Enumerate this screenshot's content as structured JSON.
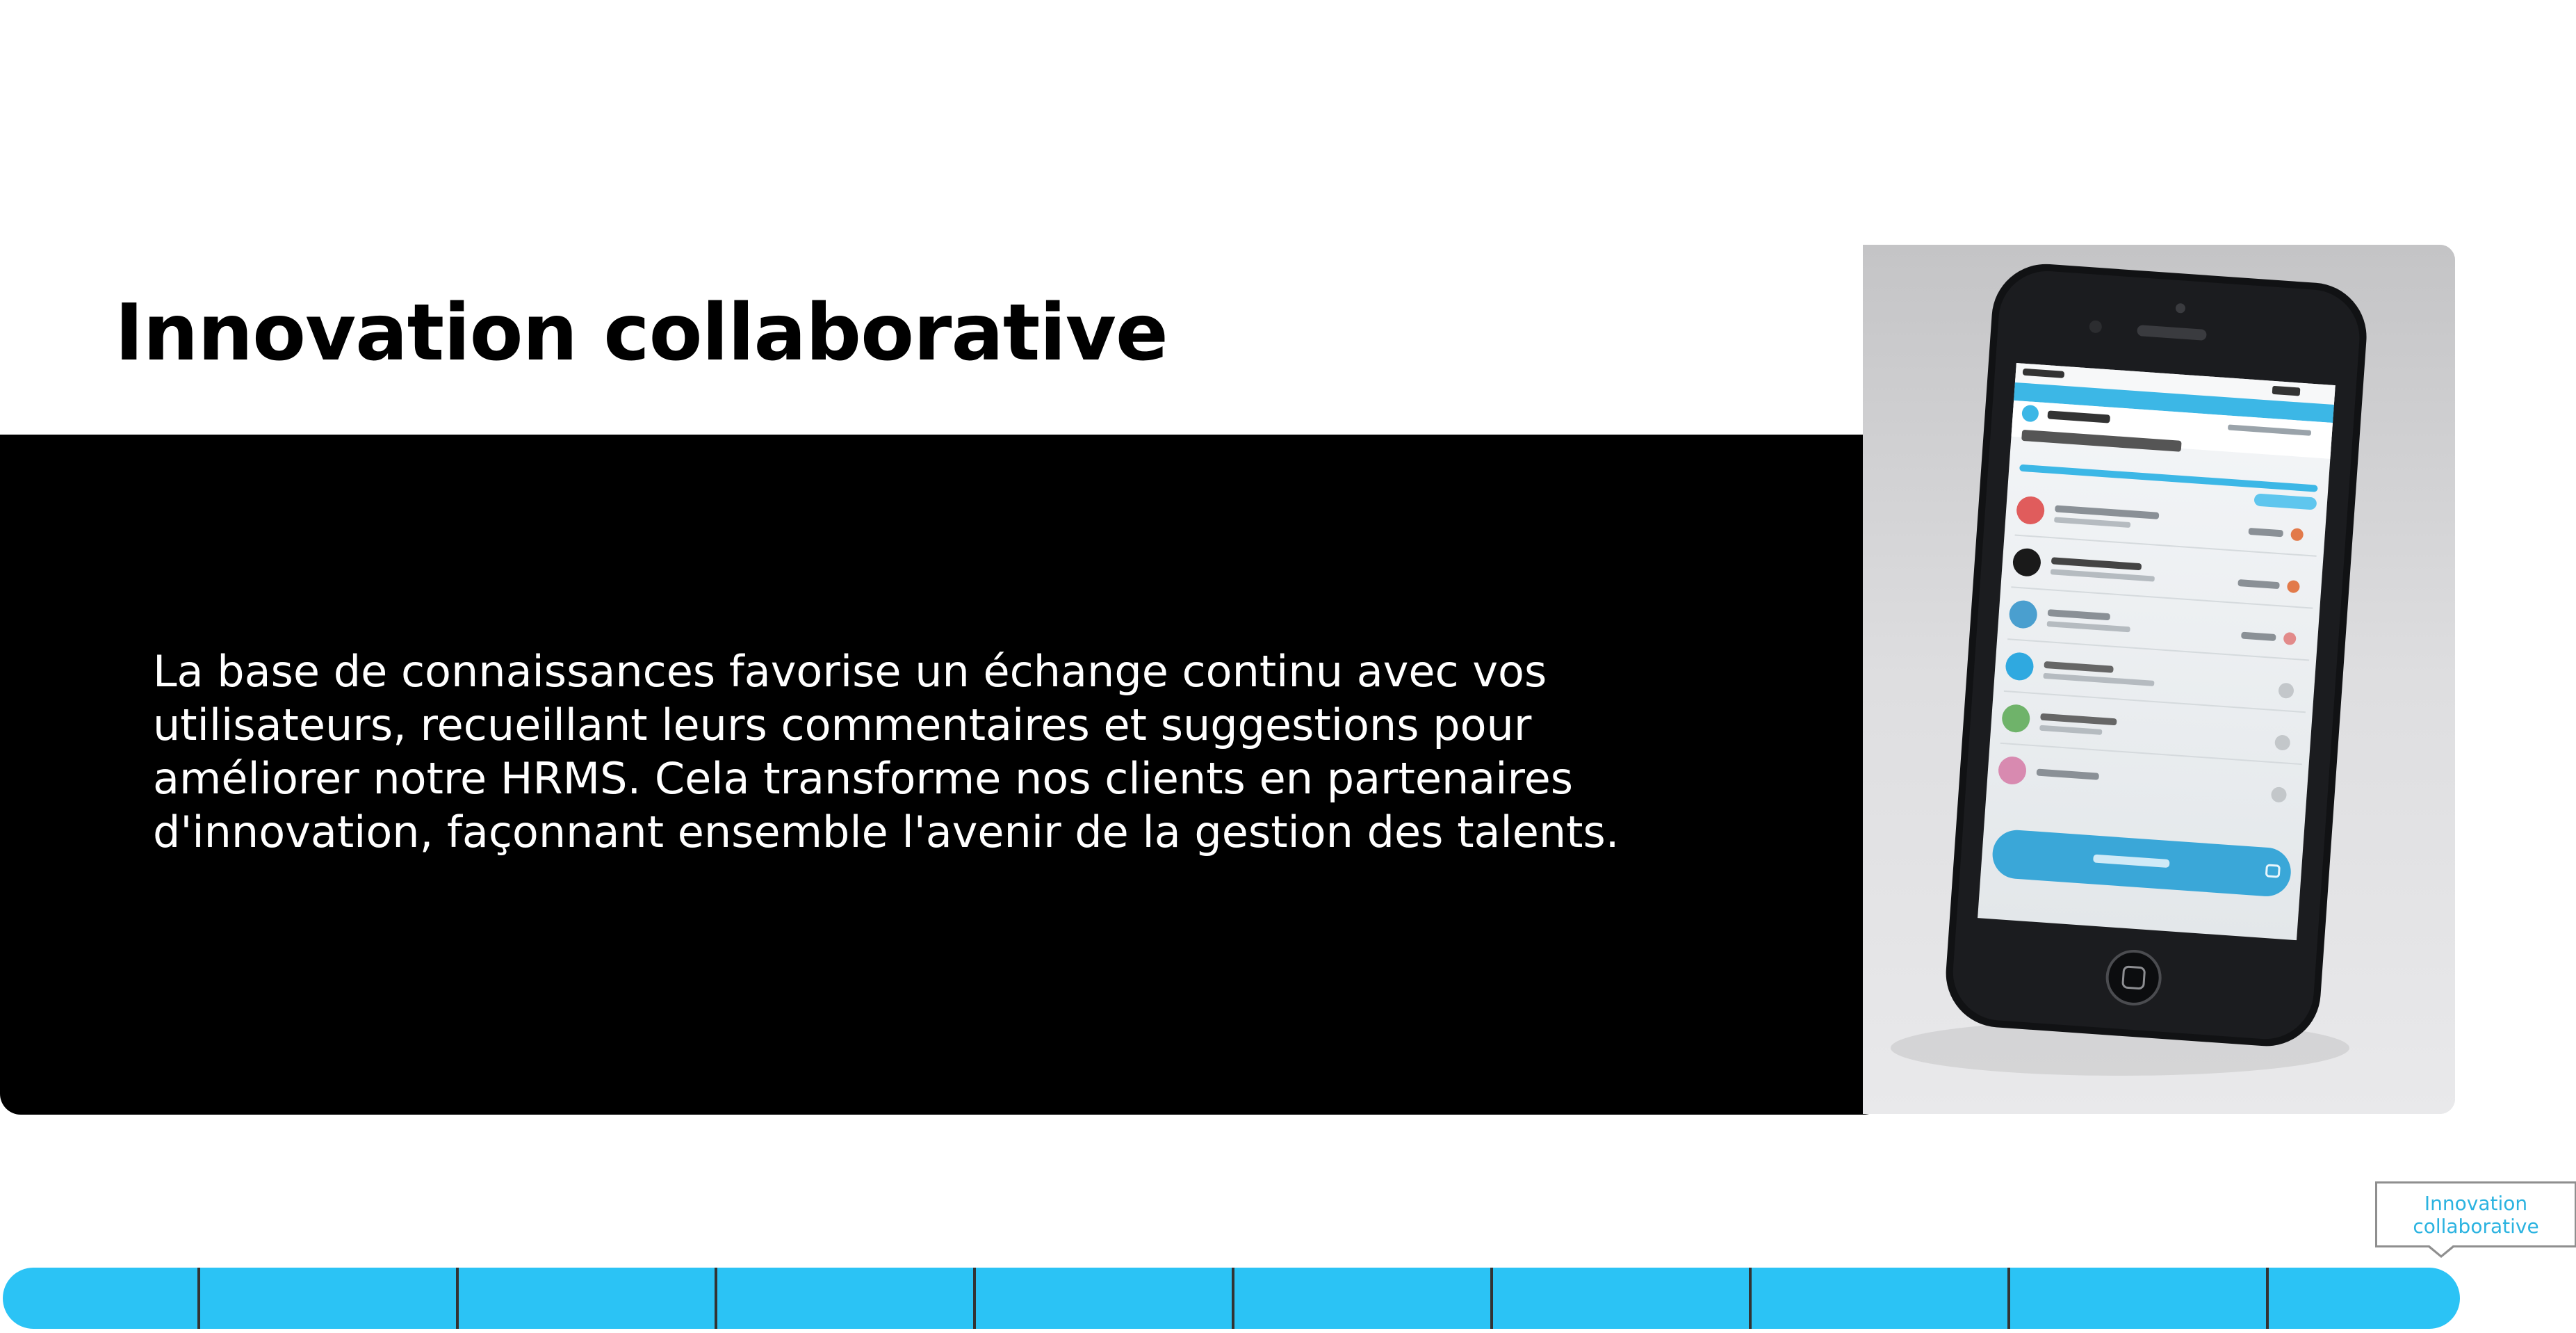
{
  "slide": {
    "title": "Innovation collaborative",
    "body": "La base de connaissances favorise un échange continu avec vos utilisateurs, recueillant leurs commentaires et suggestions pour améliorer notre HRMS. Cela transforme nos clients en partenaires d'innovation, façonnant ensemble l'avenir de la gestion des talents."
  },
  "tooltip": {
    "label": "Innovation collaborative"
  },
  "timeline": {
    "segment_count": 10,
    "active_segment": 10
  },
  "colors": {
    "accent": "#2bc3f5",
    "card": "#000000",
    "tooltip_text": "#2bb3e0"
  }
}
